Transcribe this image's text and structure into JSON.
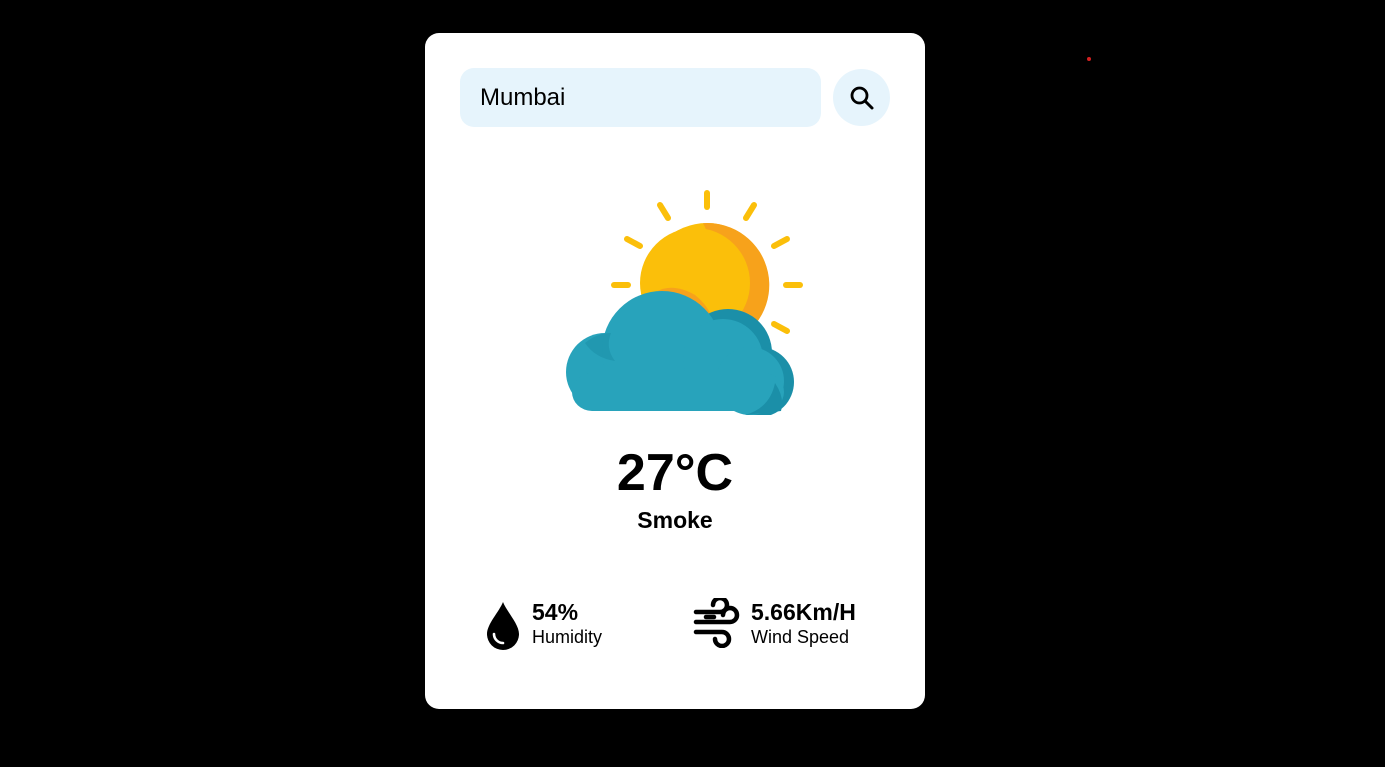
{
  "search": {
    "value": "Mumbai",
    "icon": "search-icon"
  },
  "weather": {
    "icon": "sun-cloud-icon",
    "temperature": "27°C",
    "condition": "Smoke"
  },
  "stats": {
    "humidity": {
      "value": "54%",
      "label": "Humidity",
      "icon": "water-drop-icon"
    },
    "wind": {
      "value": "5.66Km/H",
      "label": "Wind Speed",
      "icon": "wind-icon"
    }
  },
  "colors": {
    "background": "#000000",
    "card": "#ffffff",
    "input_bg": "#e6f4fc",
    "sun": "#fbbf0a",
    "sun_shade": "#f7a21b",
    "cloud": "#28a3bb",
    "cloud_shade": "#1b8fa8"
  }
}
